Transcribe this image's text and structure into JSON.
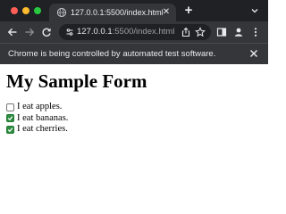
{
  "browser": {
    "tab": {
      "title": "127.0.0.1:5500/index.html",
      "favicon": "globe-icon"
    },
    "new_tab_label": "+",
    "address_bar": {
      "host": "127.0.0.1",
      "path": ":5500/index.html"
    },
    "infobar": {
      "message": "Chrome is being controlled by automated test software."
    },
    "icons": {
      "back": "back-arrow-icon",
      "forward": "forward-arrow-icon",
      "reload": "reload-icon",
      "site_info": "site-info-icon",
      "share": "share-icon",
      "bookmark": "star-icon",
      "side_panel": "side-panel-icon",
      "profile": "profile-icon",
      "menu": "more-vert-icon",
      "tab_search": "chevron-down-icon",
      "close": "close-icon"
    },
    "colors": {
      "tab_strip": "#202124",
      "toolbar": "#35363a",
      "omnibox": "#202124",
      "text": "#e8eaed",
      "dim_text": "#9aa0a6",
      "close_light": "#ff5f57",
      "minimize_light": "#febc2e",
      "maximize_light": "#28c840"
    }
  },
  "page": {
    "title": "My Sample Form",
    "checkboxes": [
      {
        "label": "I eat apples.",
        "checked": false
      },
      {
        "label": "I eat bananas.",
        "checked": true
      },
      {
        "label": "I eat cherries.",
        "checked": true
      }
    ],
    "colors": {
      "checkbox_checked": "#2e8b3f"
    }
  }
}
